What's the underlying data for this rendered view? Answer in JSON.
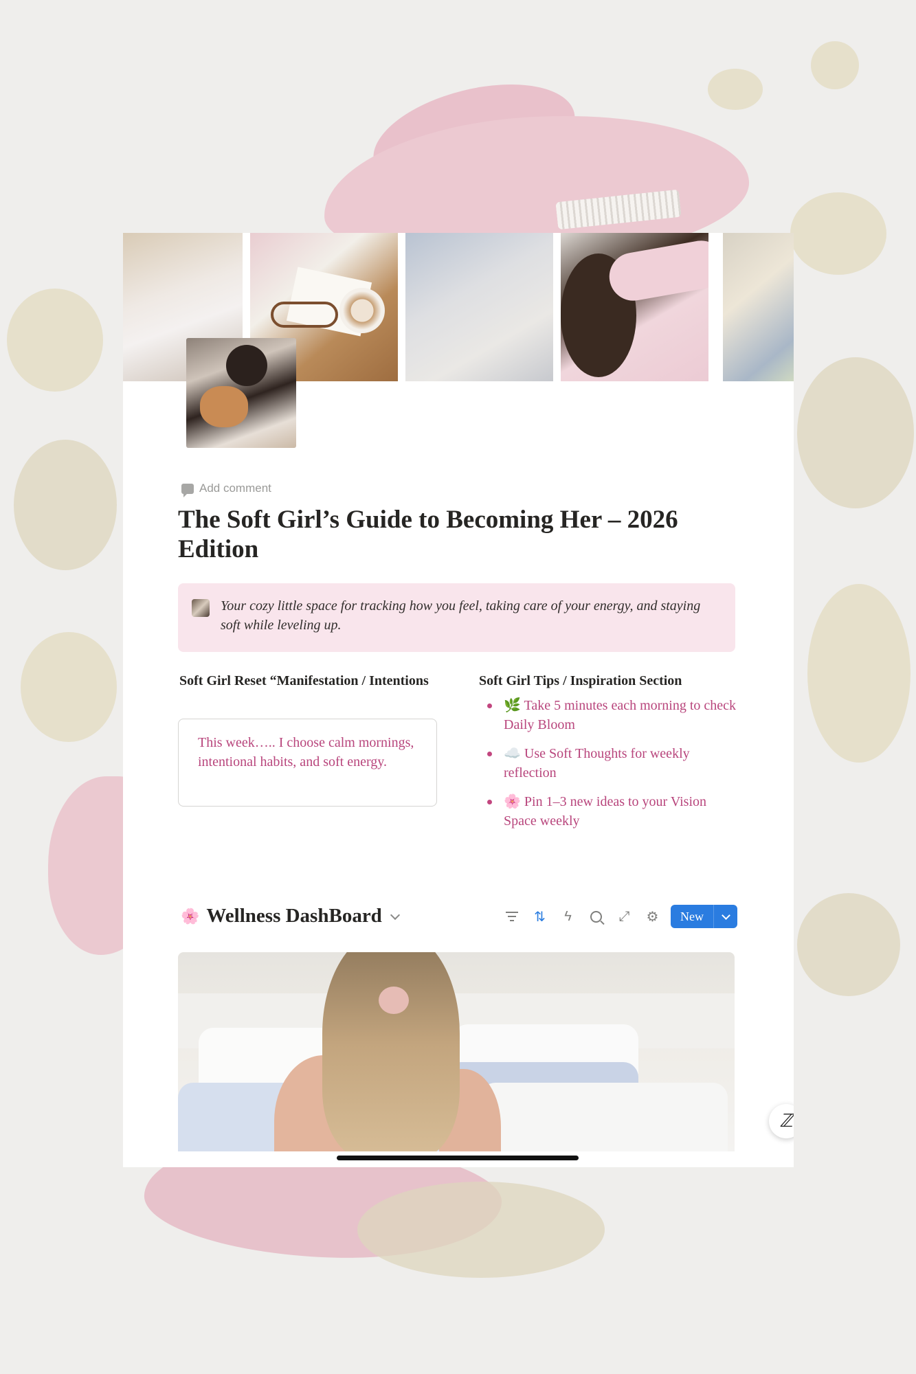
{
  "page": {
    "add_comment": "Add comment",
    "title": "The Soft Girl’s Guide to Becoming Her – 2026 Edition",
    "callout": {
      "text": "Your cozy little space for tracking how you feel, taking care of your energy, and staying soft while leveling up."
    }
  },
  "reset": {
    "heading": "Soft Girl Reset “Manifestation / Intentions",
    "intention_text": "This week….. I choose calm mornings, intentional habits, and soft energy."
  },
  "tips": {
    "heading": "Soft Girl Tips / Inspiration Section",
    "items": [
      {
        "emoji": "🌿",
        "text": "Take 5 minutes each morning to check Daily Bloom"
      },
      {
        "emoji": "☁️",
        "text": "Use Soft Thoughts for weekly reflection"
      },
      {
        "emoji": "🌸",
        "text": "Pin 1–3 new ideas to your Vision Space weekly"
      }
    ]
  },
  "dashboard": {
    "emoji": "🌸",
    "title": "Wellness DashBoard",
    "toolbar": {
      "icons": [
        "filter-icon",
        "sort-icon",
        "automation-icon",
        "search-icon",
        "expand-icon",
        "settings-icon"
      ],
      "new_label": "New"
    }
  },
  "fab": {
    "label": "ℤ"
  },
  "colors": {
    "accent_pink_text": "#b8457c",
    "callout_bg": "#f9e5ec",
    "button_blue": "#2a7ce0"
  }
}
